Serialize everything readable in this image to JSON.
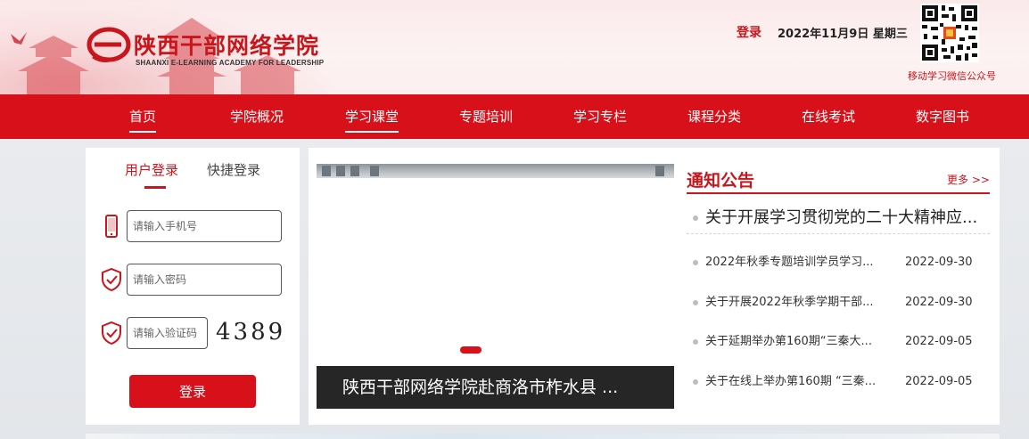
{
  "header": {
    "logo_title": "陕西干部网络学院",
    "logo_subtitle": "SHAANXI E-LEARNING ACADEMY FOR LEADERSHIP",
    "login_link": "登录",
    "date_text": "2022年11月9日  星期三",
    "qr_caption": "移动学习微信公众号",
    "brand_color": "#c8161d"
  },
  "nav": {
    "items": [
      {
        "label": "首页",
        "active": true
      },
      {
        "label": "学院概况",
        "active": false
      },
      {
        "label": "学习课堂",
        "active": true
      },
      {
        "label": "专题培训",
        "active": false
      },
      {
        "label": "学习专栏",
        "active": false
      },
      {
        "label": "课程分类",
        "active": false
      },
      {
        "label": "在线考试",
        "active": false
      },
      {
        "label": "数字图书",
        "active": false
      }
    ],
    "background_color": "#d7101a"
  },
  "login": {
    "tab_user": "用户登录",
    "tab_quick": "快捷登录",
    "phone_placeholder": "请输入手机号",
    "password_placeholder": "请输入密码",
    "captcha_placeholder": "请输入验证码",
    "captcha_code": "4389",
    "submit_label": "登录",
    "icons": [
      "phone-icon",
      "shield-check-icon",
      "shield-check-icon"
    ]
  },
  "slider": {
    "caption": "陕西干部网络学院赴商洛市柞水县 ..."
  },
  "notices": {
    "title": "通知公告",
    "more": "更多 >>",
    "headline": "关于开展学习贯彻党的二十大精神应...",
    "items": [
      {
        "title": "2022年秋季专题培训学员学习...",
        "date": "2022-09-30"
      },
      {
        "title": "关于开展2022年秋季学期干部...",
        "date": "2022-09-30"
      },
      {
        "title": "关于延期举办第160期“三秦大...",
        "date": "2022-09-05"
      },
      {
        "title": "关于在线上举办第160期 “三秦...",
        "date": "2022-09-05"
      }
    ]
  }
}
